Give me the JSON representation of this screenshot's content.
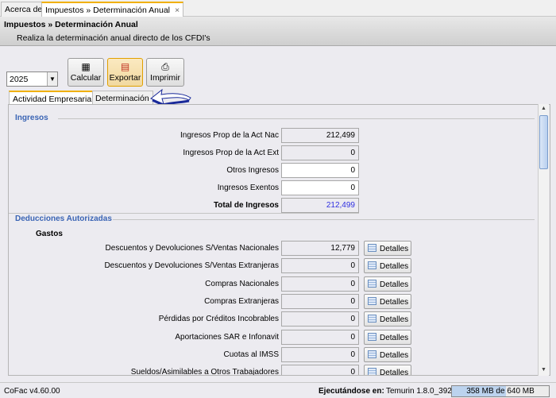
{
  "tabs": [
    {
      "label": "Acerca de"
    },
    {
      "label": "Impuestos » Determinación Anual",
      "close": "×"
    }
  ],
  "header": {
    "title": "Impuestos » Determinación Anual",
    "subtitle": "Realiza la determinación anual directo de los CFDI's"
  },
  "toolbar": {
    "year": "2025",
    "calcular": "Calcular",
    "exportar": "Exportar",
    "imprimir": "Imprimir"
  },
  "inner_tabs": [
    {
      "label": "Actividad Empresarial"
    },
    {
      "label": "Determinación"
    }
  ],
  "ingresos": {
    "title": "Ingresos",
    "rows": [
      {
        "label": "Ingresos Prop de la Act Nac",
        "value": "212,499"
      },
      {
        "label": "Ingresos Prop de la Act Ext",
        "value": "0"
      },
      {
        "label": "Otros Ingresos",
        "value": "0"
      },
      {
        "label": "Ingresos Exentos",
        "value": "0"
      },
      {
        "label": "Total de Ingresos",
        "value": "212,499"
      }
    ]
  },
  "deducciones": {
    "title": "Deducciones Autorizadas",
    "subtitle": "Gastos",
    "button": "Detalles",
    "rows": [
      {
        "label": "Descuentos y Devoluciones S/Ventas Nacionales",
        "value": "12,779"
      },
      {
        "label": "Descuentos y Devoluciones S/Ventas Extranjeras",
        "value": "0"
      },
      {
        "label": "Compras Nacionales",
        "value": "0"
      },
      {
        "label": "Compras Extranjeras",
        "value": "0"
      },
      {
        "label": "Pérdidas por Créditos Incobrables",
        "value": "0"
      },
      {
        "label": "Aportaciones SAR e Infonavit",
        "value": "0"
      },
      {
        "label": "Cuotas al IMSS",
        "value": "0"
      },
      {
        "label": "Sueldos/Asimilables a Otros Trabajadores",
        "value": "0"
      }
    ]
  },
  "status": {
    "version": "CoFac v4.60.00",
    "runtime_label": "Ejecutándose en:",
    "runtime": "Temurin 1.8.0_392",
    "memory": "358 MB de 640 MB",
    "memory_used_fraction": 0.56
  }
}
